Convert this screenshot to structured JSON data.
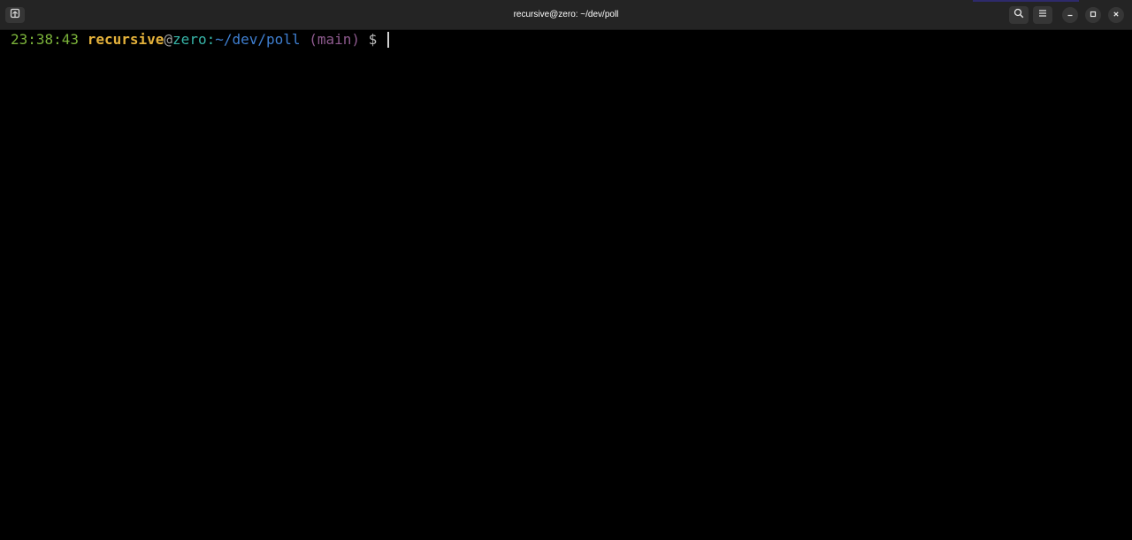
{
  "window": {
    "title": "recursive@zero: ~/dev/poll"
  },
  "titlebar": {
    "icons": [
      "new-tab-icon",
      "search-icon",
      "hamburger-menu-icon",
      "minimize-icon",
      "maximize-icon",
      "close-icon"
    ]
  },
  "terminal": {
    "prompt": {
      "time": "23:38:43",
      "user": "recursive",
      "at": "@",
      "host": "zero",
      "colon": ":",
      "path": "~/dev/poll",
      "branch": "(main)",
      "symbol": "$"
    },
    "colors": {
      "time": "#7bb33a",
      "user": "#e5b23b",
      "host": "#37b5a8",
      "path": "#3f7fd1",
      "branch": "#8e5a8e",
      "background": "#000000"
    }
  }
}
